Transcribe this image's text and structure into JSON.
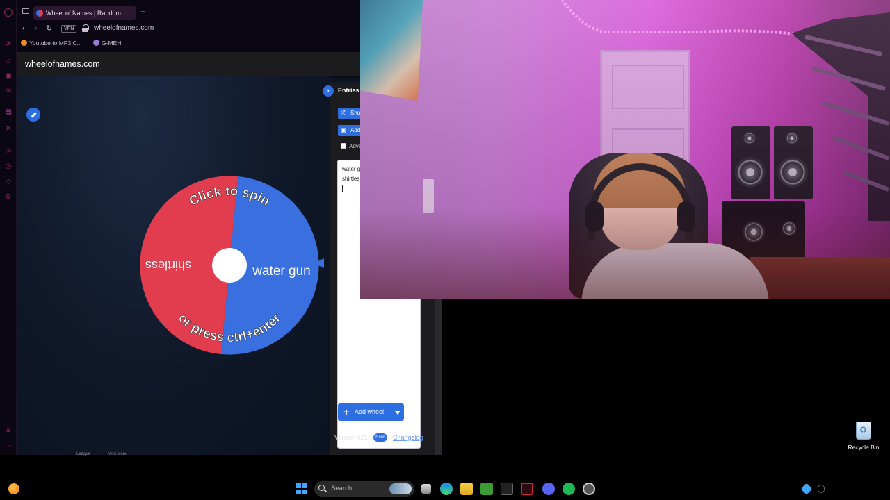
{
  "browser": {
    "tab_title": "Wheel of Names | Random",
    "url": "wheelofnames.com",
    "vpn_label": "VPN",
    "bookmarks": [
      {
        "label": "Youtube to MP3 C...",
        "color": "#f08a24"
      },
      {
        "label": "G-MEH",
        "color": "#9a7bd6"
      }
    ]
  },
  "site": {
    "title": "wheelofnames.com",
    "wheel": {
      "top_text": "Click to spin",
      "bottom_text": "or press ctrl+enter",
      "segments": [
        {
          "label": "water gun",
          "color": "#3a6fe0"
        },
        {
          "label": "shirtless",
          "color": "#e23d4e"
        }
      ]
    },
    "panel": {
      "tab_label": "Entries",
      "shuffle_label": "Shuffle",
      "add_image_label": "Add image",
      "advanced_label": "Advanced",
      "entries": [
        "water gun",
        "shirtless"
      ],
      "add_wheel_label": "Add wheel",
      "version_label": "Version 421",
      "new_badge": "New!",
      "changelog_label": "Changelog"
    },
    "footer_links": [
      "League",
      "Mod Menu"
    ]
  },
  "desktop": {
    "recycle_bin_label": "Recycle Bin"
  },
  "taskbar": {
    "search_placeholder": "Search"
  },
  "colors": {
    "accent_blue": "#2d6ee0",
    "wheel_red": "#e23d4e",
    "wheel_blue": "#3a6fe0",
    "webcam_magenta": "#d85ed8"
  }
}
